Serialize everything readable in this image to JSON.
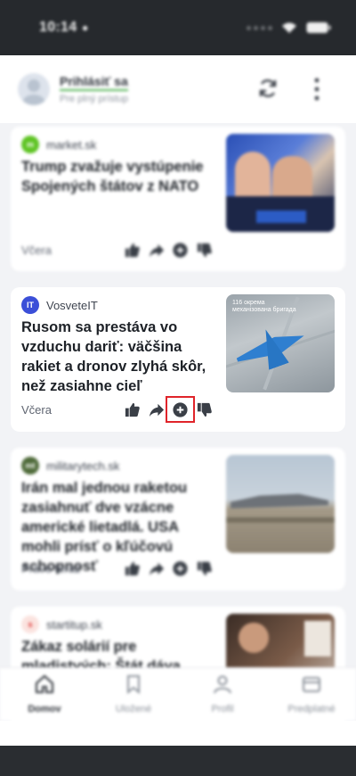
{
  "status_bar": {
    "time": "10:14"
  },
  "header": {
    "login_title": "Prihlásiť sa",
    "login_subtitle": "Pre plný prístup"
  },
  "cards": [
    {
      "source": "market.sk",
      "title": "Trump zvažuje vystúpenie Spojených štátov z NATO",
      "time": "Včera"
    },
    {
      "source": "VosveteIT",
      "source_logo": "IT",
      "title": "Rusom sa prestáva vo vzduchu dariť: väčšina rakiet a dronov zlyhá skôr, než zasiahne cieľ",
      "time": "Včera",
      "image_caption": "116 окрема механізована бригада"
    },
    {
      "source": "militarytech.sk",
      "title": "Irán mal jednou raketou zasiahnuť dve vzácne americké lietadlá. USA mohli prísť o kľúčovú schopnosť",
      "time": "Práve teraz"
    },
    {
      "source": "startitup.sk",
      "title": "Zákaz solárií pre mladistvých: Štát dáva stopku tínedžerom, výskumy"
    }
  ],
  "tabs": [
    {
      "label": "Domov",
      "icon": "home-icon",
      "active": true
    },
    {
      "label": "Uložené",
      "icon": "bookmark-icon"
    },
    {
      "label": "Profil",
      "icon": "user-icon"
    },
    {
      "label": "Predplatné",
      "icon": "subscription-icon"
    }
  ],
  "colors": {
    "status_bar_bg": "#26292d",
    "feed_bg": "#f2f3f6",
    "highlight": "#e0242a",
    "it_logo": "#3b4fd8",
    "login_underline": "#4caf50"
  }
}
